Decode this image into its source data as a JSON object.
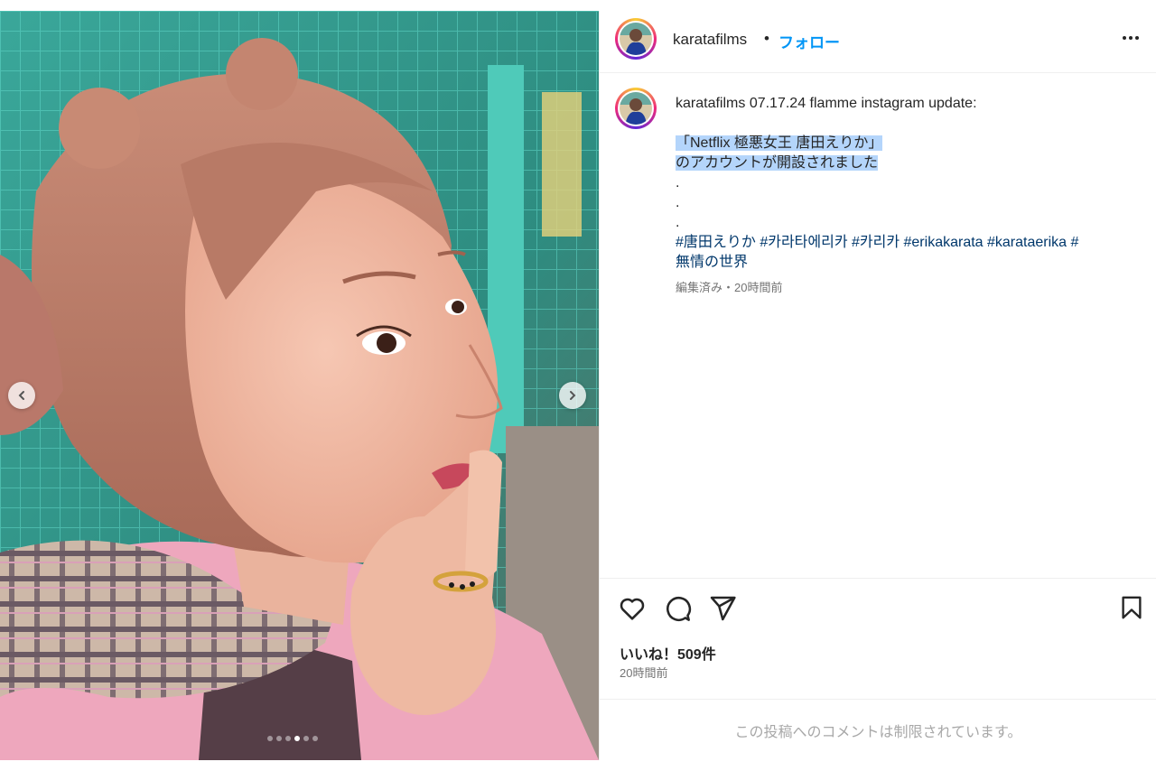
{
  "header": {
    "username": "karatafilms",
    "separator": "•",
    "follow_label": "フォロー",
    "more_icon": "more-horizontal-icon"
  },
  "post": {
    "caption_user": "karatafilms",
    "caption_intro": "07.17.24 flamme instagram update:",
    "highlight_line1": "「Netflix 極悪女王 唐田えりか」",
    "highlight_line2": "のアカウントが開設されました",
    "dot1": ".",
    "dot2": ".",
    "dot3": ".",
    "hashtags_line1": "#唐田えりか #카라타에리카 #카리카 #erikakarata #karataerika #",
    "hashtags_line2": "無情の世界",
    "meta": "編集済み・20時間前",
    "carousel_count": 6,
    "carousel_active": 4
  },
  "actions": {
    "likes": "いいね！509件",
    "time": "20時間前",
    "icons": [
      "heart-icon",
      "comment-icon",
      "share-icon",
      "bookmark-icon"
    ]
  },
  "comments": {
    "restricted": "この投稿へのコメントは制限されています。"
  },
  "colors": {
    "link_blue": "#0095f6",
    "hashtag_blue": "#00376b",
    "highlight": "#b4d5fb",
    "muted": "#737373"
  }
}
